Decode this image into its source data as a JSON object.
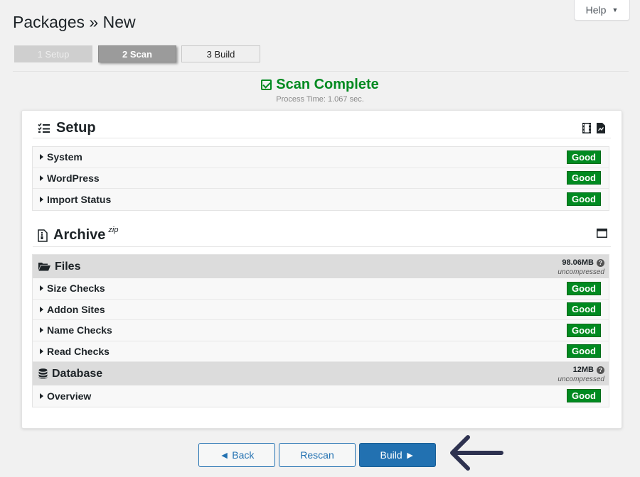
{
  "help": {
    "label": "Help"
  },
  "page": {
    "title": "Packages » New"
  },
  "steps": [
    {
      "label": "1 Setup",
      "state": "done"
    },
    {
      "label": "2 Scan",
      "state": "active"
    },
    {
      "label": "3 Build",
      "state": "pending"
    }
  ],
  "scan": {
    "title": "Scan Complete",
    "process_time": "Process Time: 1.067 sec."
  },
  "setup": {
    "title": "Setup",
    "rows": [
      {
        "label": "System",
        "status": "Good"
      },
      {
        "label": "WordPress",
        "status": "Good"
      },
      {
        "label": "Import Status",
        "status": "Good"
      }
    ]
  },
  "archive": {
    "title": "Archive",
    "format": "zip",
    "files": {
      "title": "Files",
      "size": "98.06MB",
      "size_note": "uncompressed",
      "rows": [
        {
          "label": "Size Checks",
          "status": "Good"
        },
        {
          "label": "Addon Sites",
          "status": "Good"
        },
        {
          "label": "Name Checks",
          "status": "Good"
        },
        {
          "label": "Read Checks",
          "status": "Good"
        }
      ]
    },
    "database": {
      "title": "Database",
      "size": "12MB",
      "size_note": "uncompressed",
      "rows": [
        {
          "label": "Overview",
          "status": "Good"
        }
      ]
    }
  },
  "buttons": {
    "back": "◄ Back",
    "rescan": "Rescan",
    "build": "Build ►"
  },
  "colors": {
    "good": "#008a20",
    "primary": "#2271b1",
    "success_text": "#008a20",
    "arrow": "#2e3250"
  }
}
